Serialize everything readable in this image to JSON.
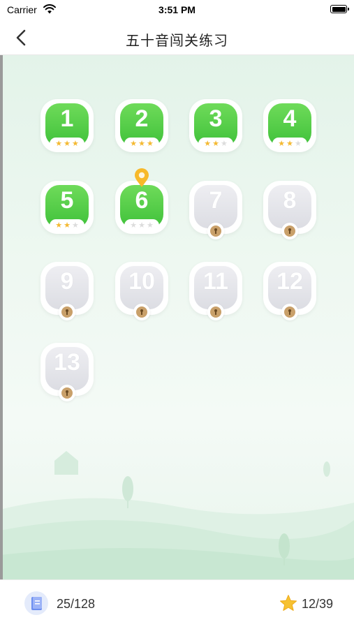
{
  "status_bar": {
    "carrier": "Carrier",
    "time": "3:51 PM"
  },
  "header": {
    "title": "五十音闯关练习"
  },
  "levels": [
    {
      "number": "1",
      "state": "completed",
      "stars": 3
    },
    {
      "number": "2",
      "state": "completed",
      "stars": 3
    },
    {
      "number": "3",
      "state": "completed",
      "stars": 2
    },
    {
      "number": "4",
      "state": "completed",
      "stars": 2
    },
    {
      "number": "5",
      "state": "completed",
      "stars": 2
    },
    {
      "number": "6",
      "state": "current",
      "stars": 0
    },
    {
      "number": "7",
      "state": "locked"
    },
    {
      "number": "8",
      "state": "locked"
    },
    {
      "number": "9",
      "state": "locked"
    },
    {
      "number": "10",
      "state": "locked"
    },
    {
      "number": "11",
      "state": "locked"
    },
    {
      "number": "12",
      "state": "locked"
    },
    {
      "number": "13",
      "state": "locked"
    }
  ],
  "footer": {
    "progress": "25/128",
    "stars": "12/39"
  },
  "colors": {
    "green": "#4ccb44",
    "star": "#f4b932",
    "locked": "#dcdde3",
    "pin": "#f7b92a"
  }
}
